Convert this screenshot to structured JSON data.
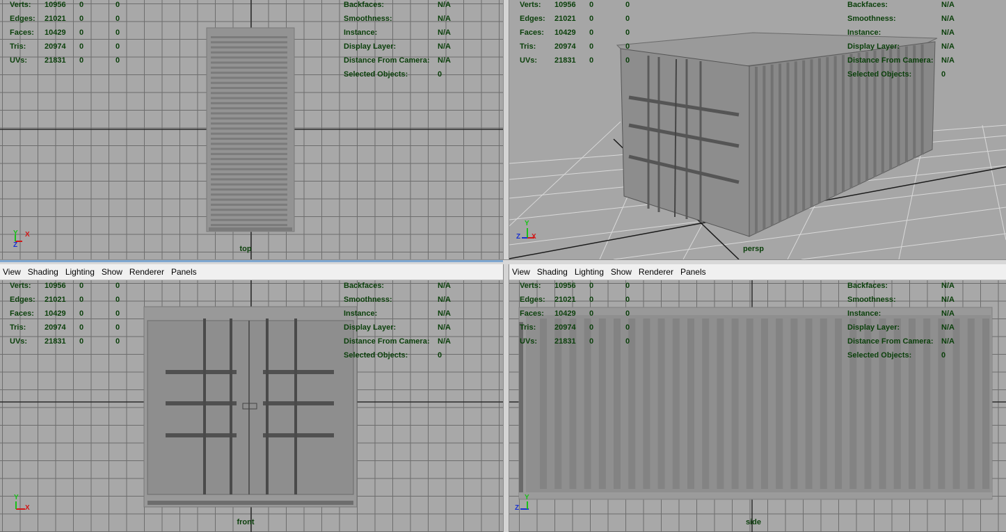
{
  "menu": [
    "View",
    "Shading",
    "Lighting",
    "Show",
    "Renderer",
    "Panels"
  ],
  "hud_left": [
    {
      "label": "Verts:",
      "v0": "10956",
      "v1": "0",
      "v2": "0"
    },
    {
      "label": "Edges:",
      "v0": "21021",
      "v1": "0",
      "v2": "0"
    },
    {
      "label": "Faces:",
      "v0": "10429",
      "v1": "0",
      "v2": "0"
    },
    {
      "label": "Tris:",
      "v0": "20974",
      "v1": "0",
      "v2": "0"
    },
    {
      "label": "UVs:",
      "v0": "21831",
      "v1": "0",
      "v2": "0"
    }
  ],
  "hud_right": [
    {
      "label": "Backfaces:",
      "value": "N/A"
    },
    {
      "label": "Smoothness:",
      "value": "N/A"
    },
    {
      "label": "Instance:",
      "value": "N/A"
    },
    {
      "label": "Display Layer:",
      "value": "N/A"
    },
    {
      "label": "Distance From Camera:",
      "value": "N/A"
    },
    {
      "label": "Selected Objects:",
      "value": "0"
    }
  ],
  "viewports": {
    "top": {
      "camera": "top"
    },
    "persp": {
      "camera": "persp"
    },
    "front": {
      "camera": "front"
    },
    "side": {
      "camera": "side"
    }
  },
  "axis": {
    "x": "X",
    "y": "Y",
    "z": "Z"
  },
  "colors": {
    "hud_text": "#0a3f0a",
    "grid_line": "#6d6d6d",
    "viewport_bg": "#a8a8a8",
    "model": "#8e8e8e",
    "axis_x": "#d01818",
    "axis_y": "#18c018",
    "axis_z": "#1830d0"
  }
}
